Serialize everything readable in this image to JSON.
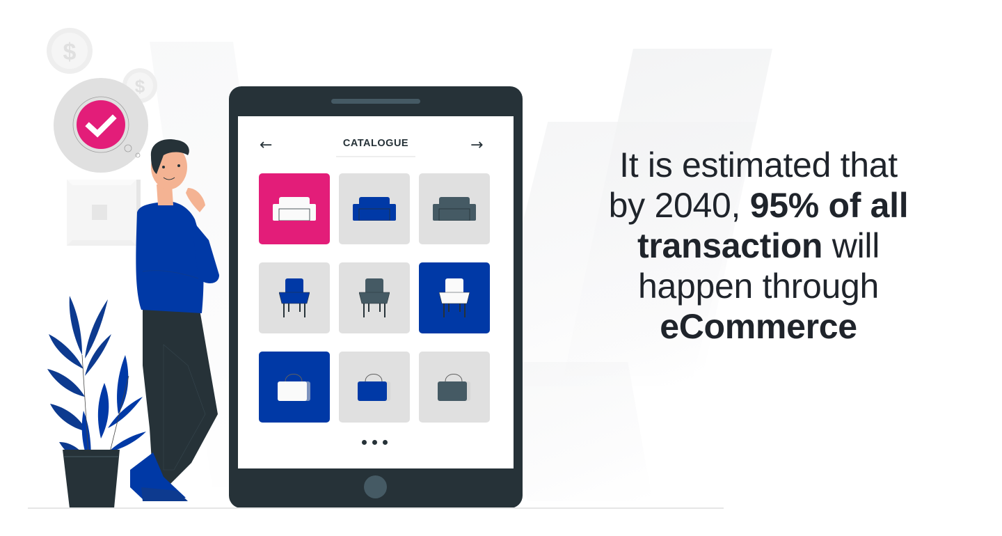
{
  "catalogue": {
    "title": "CATALOGUE",
    "prev_icon": "arrow-left-icon",
    "next_icon": "arrow-right-icon",
    "prev_glyph": "←",
    "next_glyph": "→",
    "more_icon": "ellipsis-icon",
    "items": [
      {
        "type": "sofa",
        "selected": true,
        "tile_color": "#e31d79",
        "item_color": "#fafafa"
      },
      {
        "type": "sofa",
        "selected": false,
        "tile_color": "#e0e0e0",
        "item_color": "#0039a6"
      },
      {
        "type": "sofa",
        "selected": false,
        "tile_color": "#e0e0e0",
        "item_color": "#455a64"
      },
      {
        "type": "armchair",
        "selected": false,
        "tile_color": "#e0e0e0",
        "item_color": "#0039a6"
      },
      {
        "type": "armchair",
        "selected": false,
        "tile_color": "#e0e0e0",
        "item_color": "#455a64"
      },
      {
        "type": "armchair",
        "selected": true,
        "tile_color": "#0039a6",
        "item_color": "#fafafa"
      },
      {
        "type": "bag",
        "selected": true,
        "tile_color": "#0039a6",
        "item_color": "#fafafa"
      },
      {
        "type": "bag",
        "selected": false,
        "tile_color": "#e0e0e0",
        "item_color": "#0039a6"
      },
      {
        "type": "bag",
        "selected": false,
        "tile_color": "#e0e0e0",
        "item_color": "#455a64"
      }
    ]
  },
  "headline": {
    "line1": "It is estimated that",
    "line2_regular": "by 2040, ",
    "line2_bold": "95% of all",
    "line3_bold": "transaction",
    "line3_regular": " will",
    "line4": "happen through",
    "line5_bold": "eCommerce"
  },
  "illustration": {
    "check_icon": "checkmark-icon",
    "coin_symbol": "$",
    "colors": {
      "accent_pink": "#e31d79",
      "brand_blue": "#0039a6",
      "dark": "#263238",
      "slate": "#455a64",
      "light_gray": "#e0e0e0"
    }
  }
}
